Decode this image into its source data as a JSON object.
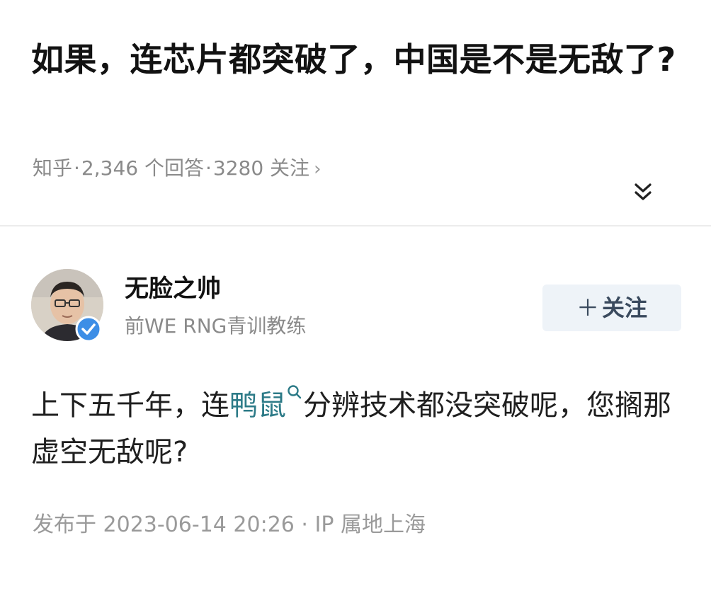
{
  "question": {
    "title": "如果，连芯片都突破了，中国是不是无敌了?",
    "source": "知乎",
    "answer_count": "2,346 个回答",
    "follow_count": "3280 关注",
    "sep": "·",
    "chevron": "›"
  },
  "author": {
    "name": "无脸之帅",
    "description": "前WE RNG青训教练",
    "follow_label": "关注",
    "follow_plus": "＋"
  },
  "answer": {
    "text_before": "上下五千年，连",
    "link_text": "鸭鼠",
    "text_after": "分辨技术都没突破呢，您搁那虚空无敌呢?"
  },
  "publish": {
    "text": "发布于 2023-06-14 20:26 · IP 属地上海"
  },
  "icons": {
    "expand": "double-chevron-down-icon",
    "search": "search-icon",
    "verified": "verified-badge-icon"
  },
  "colors": {
    "link": "#2c7a87",
    "meta": "#8a8a8a",
    "follow_bg": "#eef3f8",
    "verified": "#3d8ee6"
  }
}
